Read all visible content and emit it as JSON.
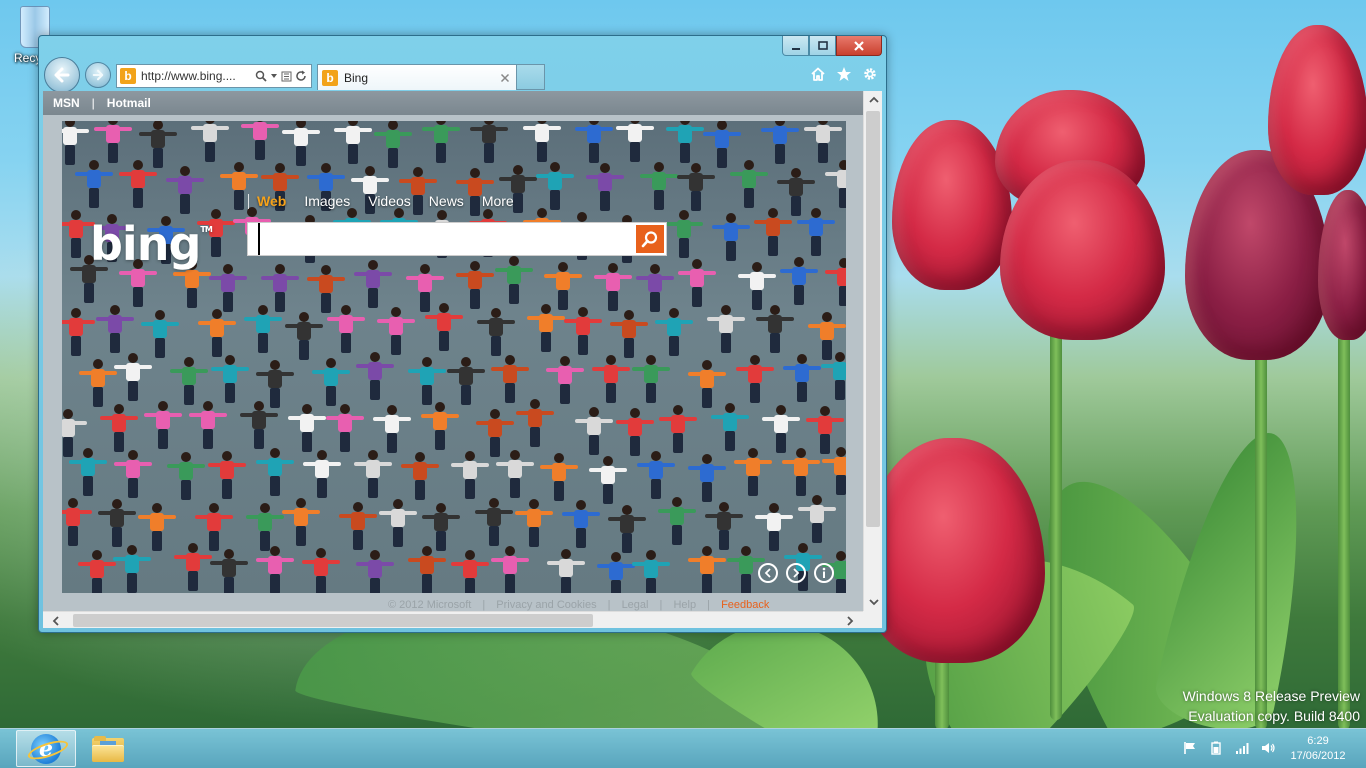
{
  "desktop": {
    "recycle_bin_label": "Recycle Bin",
    "watermark": {
      "line1": "Windows 8 Release Preview",
      "line2": "Evaluation copy. Build 8400"
    }
  },
  "browser": {
    "address_url": "http://www.bing....",
    "tab_title": "Bing",
    "favorites_bar": {
      "items": [
        "MSN",
        "Hotmail"
      ],
      "separator": "|"
    },
    "page": {
      "logo_text": "bing",
      "logo_tm": "TM",
      "nav": [
        "Web",
        "Images",
        "Videos",
        "News",
        "More"
      ],
      "active_nav": "Web",
      "search_value": "",
      "footer": [
        "© 2012 Microsoft",
        "|",
        "Privacy and Cookies",
        "|",
        "Legal",
        "|",
        "Help",
        "|",
        "Feedback"
      ]
    }
  },
  "taskbar": {
    "time": "6:29",
    "date": "17/06/2012"
  },
  "colors": {
    "bing_orange": "#f6a21a",
    "search_button": "#e8611c",
    "close_button": "#c9402e"
  },
  "icons": {
    "back": "arrow-left-icon",
    "forward": "arrow-right-icon",
    "home": "home-icon",
    "favorites": "star-icon",
    "tools": "gear-icon",
    "search": "magnifier-icon"
  }
}
